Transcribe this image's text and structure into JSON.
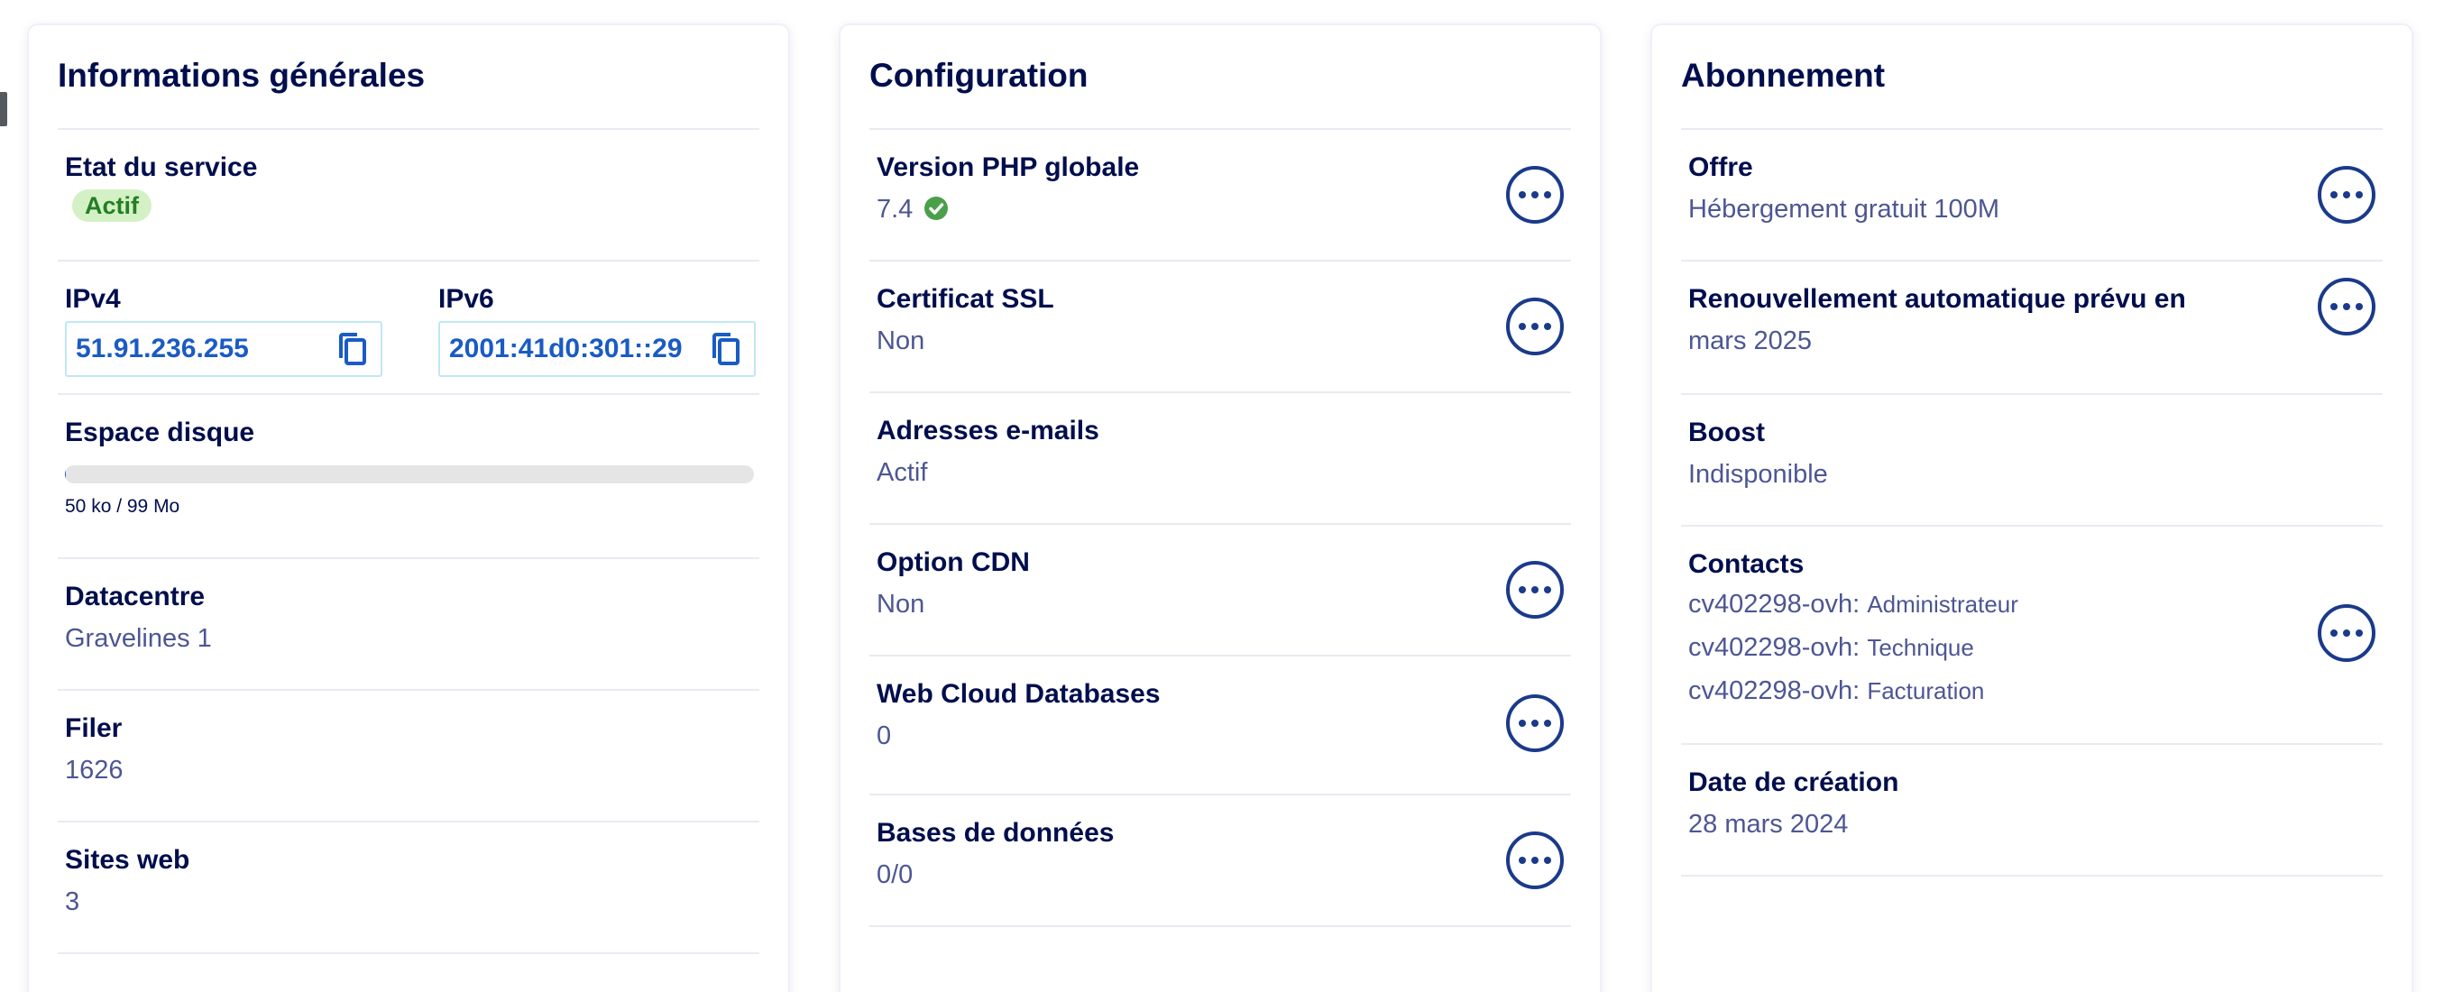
{
  "general": {
    "title": "Informations générales",
    "service_state": {
      "label": "Etat du service",
      "badge": "Actif",
      "badge_color": "#d4f1c5"
    },
    "ipv4": {
      "label": "IPv4",
      "value": "51.91.236.255"
    },
    "ipv6": {
      "label": "IPv6",
      "value": "2001:41d0:301::29"
    },
    "disk": {
      "label": "Espace disque",
      "caption": "50 ko / 99 Mo",
      "fill_percent": 0.05
    },
    "datacentre": {
      "label": "Datacentre",
      "value": "Gravelines 1"
    },
    "filer": {
      "label": "Filer",
      "value": "1626"
    },
    "websites": {
      "label": "Sites web",
      "value": "3"
    }
  },
  "config": {
    "title": "Configuration",
    "php": {
      "label": "Version PHP globale",
      "value": "7.4",
      "status_icon": "check-circle-icon"
    },
    "ssl": {
      "label": "Certificat SSL",
      "value": "Non"
    },
    "emails": {
      "label": "Adresses e-mails",
      "value": "Actif"
    },
    "cdn": {
      "label": "Option CDN",
      "value": "Non"
    },
    "web_cloud_db": {
      "label": "Web Cloud Databases",
      "value": "0"
    },
    "databases": {
      "label": "Bases de données",
      "value": "0/0"
    }
  },
  "subscription": {
    "title": "Abonnement",
    "offer": {
      "label": "Offre",
      "value": "Hébergement gratuit 100M"
    },
    "renewal": {
      "label": "Renouvellement automatique prévu en",
      "value": "mars 2025"
    },
    "boost": {
      "label": "Boost",
      "value": "Indisponible"
    },
    "contacts": {
      "label": "Contacts",
      "items": [
        {
          "account": "cv402298-ovh:",
          "role": "Administrateur"
        },
        {
          "account": "cv402298-ovh:",
          "role": "Technique"
        },
        {
          "account": "cv402298-ovh:",
          "role": "Facturation"
        }
      ]
    },
    "creation": {
      "label": "Date de création",
      "value": "28 mars 2024"
    }
  },
  "colors": {
    "title": "#000e4d",
    "value": "#4d5693",
    "link": "#1a5bc4",
    "success": "#4aa04a",
    "button_border": "#1a3a8a"
  }
}
